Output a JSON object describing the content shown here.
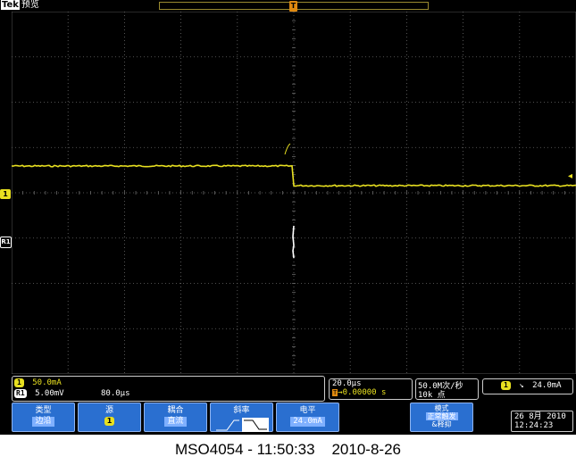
{
  "header": {
    "brand": "Tek",
    "mode": "预览"
  },
  "markers": {
    "trigger_position": "T",
    "ch1_ground": "1",
    "ref1": "R1"
  },
  "colors": {
    "ch1": "#e8e020",
    "grid": "#6a6a6a",
    "button_bg": "#2a6fd0",
    "screen_bg": "#000000"
  },
  "status": {
    "ch1_badge": "1",
    "ch1_scale": "50.0mA",
    "ref_badge": "R1",
    "ref_scale": "5.00mV",
    "ref_time": "80.0μs",
    "horiz_scale": "20.0μs",
    "horiz_delay": "0.00000 s",
    "sample_rate": "50.0M次/秒",
    "record_length": "10k 点",
    "trig_badge": "1",
    "trig_slope_symbol": "↘",
    "trig_level": "24.0mA"
  },
  "menu": {
    "type_label": "类型",
    "type_value": "边沿",
    "source_label": "源",
    "source_value": "1",
    "coupling_label": "耦合",
    "coupling_value": "直流",
    "slope_label": "斜率",
    "level_label": "电平",
    "level_value": "24.0mA",
    "mode_label": "模式",
    "mode_value1": "正常触发",
    "mode_value2": "&释抑"
  },
  "datetime": {
    "date": "26 8月 2010",
    "time": "12:24:23"
  },
  "footer": {
    "caption": "MSO4054 - 11:50:33    2010-8-26"
  }
}
